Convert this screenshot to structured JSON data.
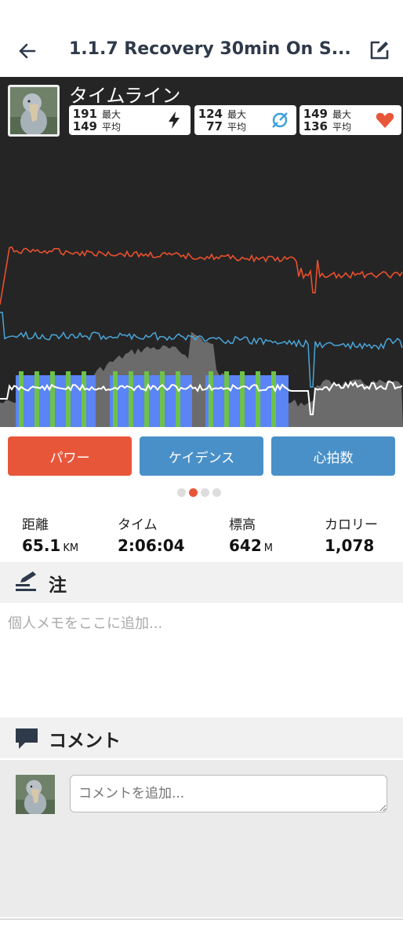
{
  "header": {
    "title": "1.1.7 Recovery 30min On S...",
    "back_icon": "arrow-left-icon",
    "edit_icon": "edit-note-icon"
  },
  "timeline": {
    "label": "タイムライン",
    "stats": [
      {
        "max": "191",
        "max_label": "最大",
        "avg": "149",
        "avg_label": "平均",
        "icon": "lightning-icon",
        "icon_color": "#222222"
      },
      {
        "max": "124",
        "max_label": "最大",
        "avg": "77",
        "avg_label": "平均",
        "icon": "cadence-icon",
        "icon_color": "#3aa0db"
      },
      {
        "max": "149",
        "max_label": "最大",
        "avg": "136",
        "avg_label": "平均",
        "icon": "heart-icon",
        "icon_color": "#e8563a"
      }
    ],
    "colors": {
      "power": "#e8502f",
      "cadence": "#4aa5d8",
      "heart": "#ffffff",
      "elevation": "#6b6b6b",
      "zone_blue": "#5b84f4",
      "zone_green": "#6cc24a"
    }
  },
  "tabs": [
    {
      "label": "パワー",
      "color": "#e8563a"
    },
    {
      "label": "ケイデンス",
      "color": "#4a90c8"
    },
    {
      "label": "心拍数",
      "color": "#4a90c8"
    }
  ],
  "pager": {
    "count": 4,
    "active": 1,
    "active_color": "#e8563a"
  },
  "summary": [
    {
      "label": "距離",
      "value": "65.1",
      "unit": "KM"
    },
    {
      "label": "タイム",
      "value": "2:06:04",
      "unit": ""
    },
    {
      "label": "標高",
      "value": "642",
      "unit": "M"
    },
    {
      "label": "カロリー",
      "value": "1,078",
      "unit": ""
    }
  ],
  "notes": {
    "title": "注",
    "icon": "notes-pen-icon",
    "placeholder": "個人メモをここに追加..."
  },
  "comments": {
    "title": "コメント",
    "icon": "comment-bubble-icon",
    "placeholder": "コメントを追加..."
  }
}
